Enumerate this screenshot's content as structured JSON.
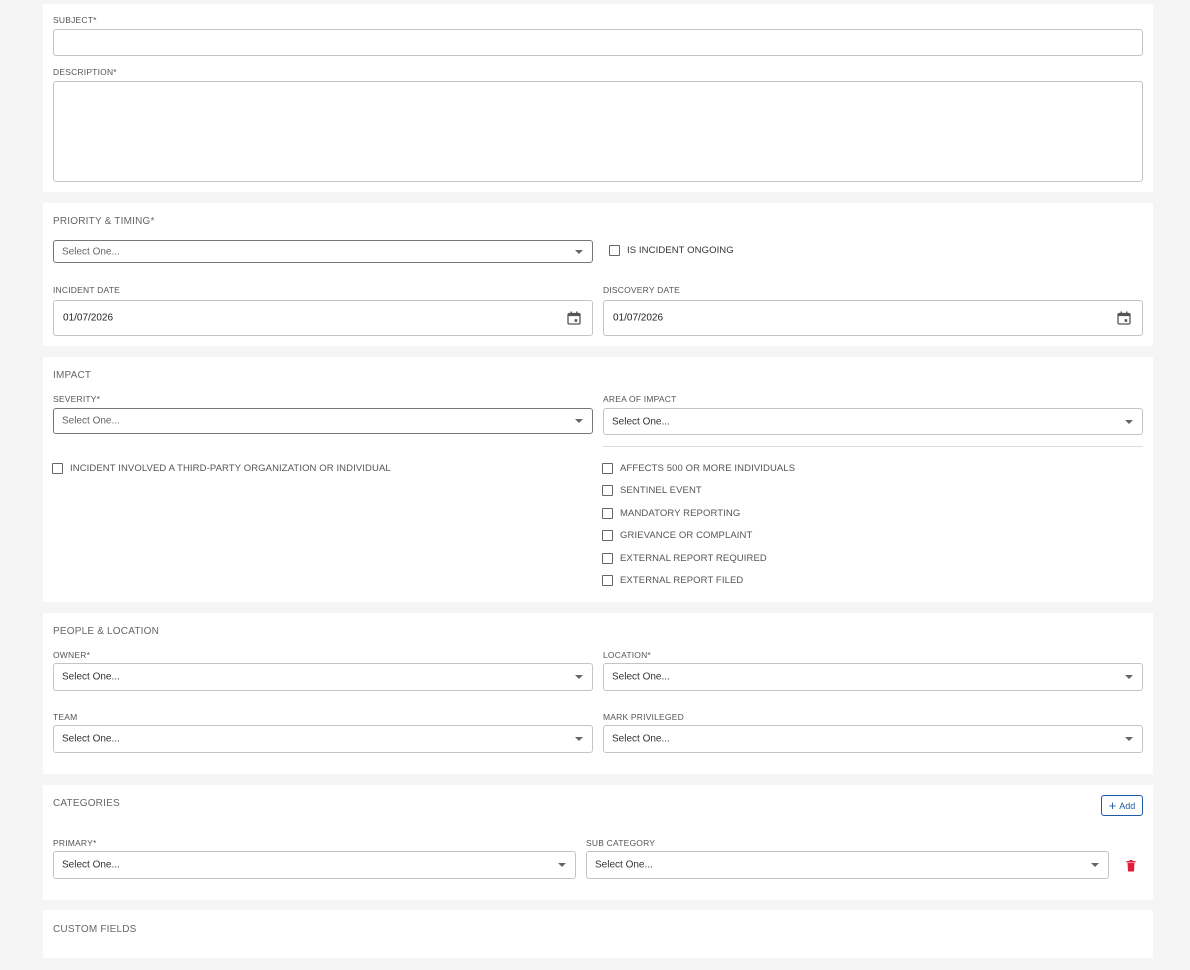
{
  "details": {
    "subject_label": "SUBJECT*",
    "subject_value": "",
    "description_label": "DESCRIPTION*",
    "description_value": ""
  },
  "priority": {
    "title": "PRIORITY & TIMING*",
    "select_value": "Select One...",
    "ongoing_label": "IS INCIDENT ONGOING",
    "incident_date_label": "INCIDENT DATE",
    "incident_date_value": "01/07/2026",
    "discovery_date_label": "DISCOVERY DATE",
    "discovery_date_value": "01/07/2026"
  },
  "impact": {
    "title": "IMPACT",
    "severity_label": "SEVERITY*",
    "severity_value": "Select One...",
    "area_label": "AREA OF IMPACT",
    "area_value": "Select One...",
    "third_party_label": "INCIDENT INVOLVED A THIRD-PARTY ORGANIZATION OR INDIVIDUAL",
    "flags": [
      "AFFECTS 500 OR MORE INDIVIDUALS",
      "SENTINEL EVENT",
      "MANDATORY REPORTING",
      "GRIEVANCE OR COMPLAINT",
      "EXTERNAL REPORT REQUIRED",
      "EXTERNAL REPORT FILED"
    ]
  },
  "people": {
    "title": "PEOPLE & LOCATION",
    "owner_label": "OWNER*",
    "owner_value": "Select One...",
    "location_label": "LOCATION*",
    "location_value": "Select One...",
    "team_label": "TEAM",
    "team_value": "Select One...",
    "privileged_label": "MARK PRIVILEGED",
    "privileged_value": "Select One..."
  },
  "categories": {
    "title": "CATEGORIES",
    "add_label": "Add",
    "primary_label": "PRIMARY*",
    "primary_value": "Select One...",
    "sub_label": "SUB CATEGORY",
    "sub_value": "Select One...",
    "delete_color": "#e0203a"
  },
  "custom": {
    "title": "CUSTOM FIELDS"
  },
  "colors": {
    "accent": "#1f5aa6",
    "danger": "#e0203a",
    "background": "#f5f5f5"
  }
}
